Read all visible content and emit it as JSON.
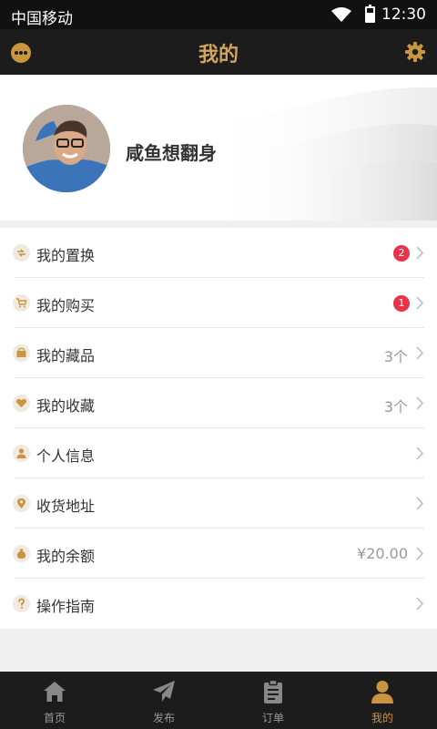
{
  "status_bar": {
    "carrier": "中国移动",
    "time": "12:30"
  },
  "header": {
    "title": "我的"
  },
  "profile": {
    "name": "咸鱼想翻身"
  },
  "menu": [
    {
      "label": "我的置换",
      "badge": "2",
      "value": "",
      "icon": "swap-icon"
    },
    {
      "label": "我的购买",
      "badge": "1",
      "value": "",
      "icon": "cart-icon"
    },
    {
      "label": "我的藏品",
      "badge": "",
      "value": "3个",
      "icon": "box-icon"
    },
    {
      "label": "我的收藏",
      "badge": "",
      "value": "3个",
      "icon": "heart-icon"
    },
    {
      "label": "个人信息",
      "badge": "",
      "value": "",
      "icon": "person-icon"
    },
    {
      "label": "收货地址",
      "badge": "",
      "value": "",
      "icon": "location-icon"
    },
    {
      "label": "我的余额",
      "badge": "",
      "value": "¥20.00",
      "icon": "money-bag-icon"
    },
    {
      "label": "操作指南",
      "badge": "",
      "value": "",
      "icon": "question-icon"
    }
  ],
  "tabs": [
    {
      "label": "首页",
      "icon": "home-icon",
      "active": false
    },
    {
      "label": "发布",
      "icon": "paper-plane-icon",
      "active": false
    },
    {
      "label": "订单",
      "icon": "clipboard-icon",
      "active": false
    },
    {
      "label": "我的",
      "icon": "user-icon",
      "active": true
    }
  ],
  "colors": {
    "accent": "#c9953f",
    "badge": "#e8344a",
    "dark": "#1c1c1c"
  }
}
